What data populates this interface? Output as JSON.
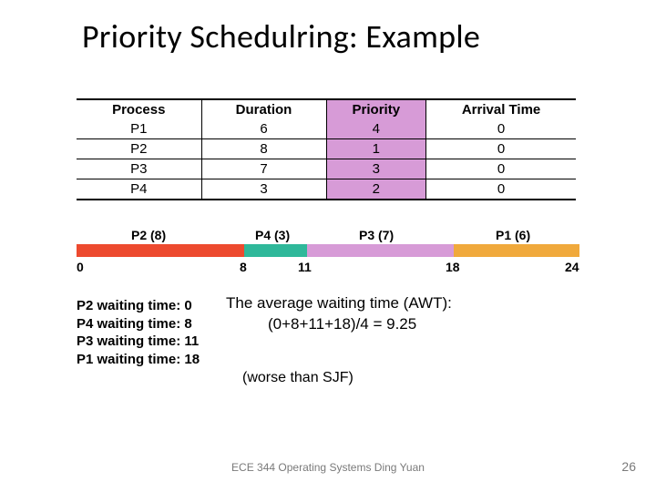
{
  "title": "Priority Schedulring: Example",
  "table": {
    "headers": {
      "process": "Process",
      "duration": "Duration",
      "priority": "Priority",
      "arrival": "Arrival Time"
    },
    "rows": [
      {
        "process": "P1",
        "duration": "6",
        "priority": "4",
        "arrival": "0"
      },
      {
        "process": "P2",
        "duration": "8",
        "priority": "1",
        "arrival": "0"
      },
      {
        "process": "P3",
        "duration": "7",
        "priority": "3",
        "arrival": "0"
      },
      {
        "process": "P4",
        "duration": "3",
        "priority": "2",
        "arrival": "0"
      }
    ]
  },
  "gantt": {
    "total": 24,
    "segments": [
      {
        "name": "P2",
        "len": 8,
        "label": "P2 (8)",
        "color": "seg-p2"
      },
      {
        "name": "P4",
        "len": 3,
        "label": "P4 (3)",
        "color": "seg-p4"
      },
      {
        "name": "P3",
        "len": 7,
        "label": "P3 (7)",
        "color": "seg-p3"
      },
      {
        "name": "P1",
        "len": 6,
        "label": "P1 (6)",
        "color": "seg-p1"
      }
    ],
    "ticks": {
      "t0": "0",
      "t1": "8",
      "t2": "11",
      "t3": "18",
      "t4": "24"
    }
  },
  "waiting": {
    "l1": "P2 waiting time: 0",
    "l2": "P4 waiting time: 8",
    "l3": "P3 waiting time: 11",
    "l4": "P1 waiting time: 18"
  },
  "awt": {
    "line1": "The average waiting time (AWT):",
    "line2": "(0+8+11+18)/4 = 9.25"
  },
  "worse": "(worse than SJF)",
  "footer": {
    "course": "ECE 344 Operating Systems Ding Yuan",
    "page": "26"
  },
  "chart_data": {
    "type": "table",
    "title": "Priority Scheduling Example",
    "columns": [
      "Process",
      "Duration",
      "Priority",
      "Arrival Time"
    ],
    "rows": [
      [
        "P1",
        6,
        4,
        0
      ],
      [
        "P2",
        8,
        1,
        0
      ],
      [
        "P3",
        7,
        3,
        0
      ],
      [
        "P4",
        3,
        2,
        0
      ]
    ],
    "gantt_order": [
      {
        "process": "P2",
        "start": 0,
        "end": 8
      },
      {
        "process": "P4",
        "start": 8,
        "end": 11
      },
      {
        "process": "P3",
        "start": 11,
        "end": 18
      },
      {
        "process": "P1",
        "start": 18,
        "end": 24
      }
    ],
    "waiting_times": {
      "P2": 0,
      "P4": 8,
      "P3": 11,
      "P1": 18
    },
    "average_waiting_time": 9.25
  }
}
